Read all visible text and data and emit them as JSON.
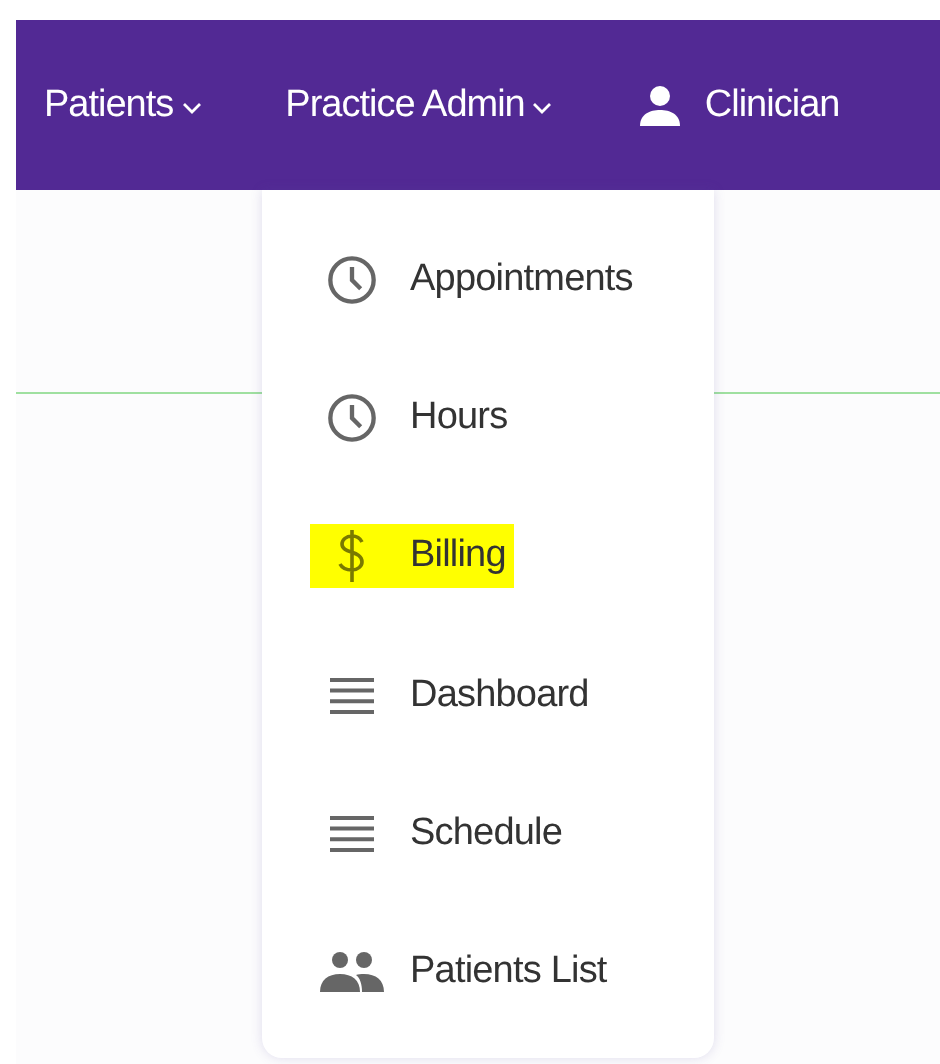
{
  "nav": {
    "items": [
      {
        "label": "Patients",
        "kind": "dropdown"
      },
      {
        "label": "Practice Admin",
        "kind": "dropdown"
      },
      {
        "label": "Clinician",
        "kind": "user"
      }
    ]
  },
  "menu": {
    "items": [
      {
        "label": "Appointments",
        "kind": "clock",
        "highlighted": false
      },
      {
        "label": "Hours",
        "kind": "clock",
        "highlighted": false
      },
      {
        "label": "Billing",
        "kind": "dollar",
        "highlighted": true
      },
      {
        "label": "Dashboard",
        "kind": "lines",
        "highlighted": false
      },
      {
        "label": "Schedule",
        "kind": "lines",
        "highlighted": false
      },
      {
        "label": "Patients List",
        "kind": "people",
        "highlighted": false
      }
    ]
  }
}
